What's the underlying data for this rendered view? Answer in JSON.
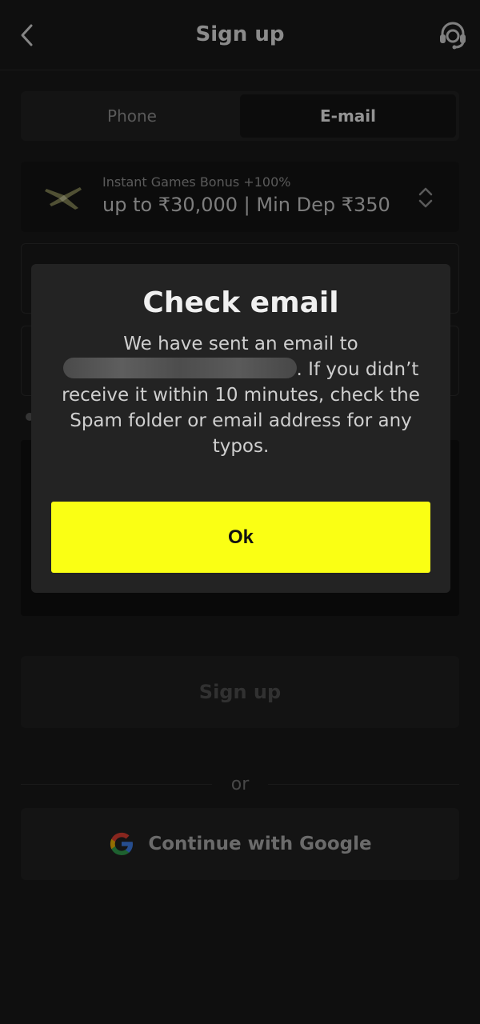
{
  "header": {
    "title": "Sign up",
    "back_icon": "chevron-left-icon",
    "support_icon": "headset-support-icon"
  },
  "tabs": [
    {
      "label": "Phone",
      "active": false
    },
    {
      "label": "E-mail",
      "active": true
    }
  ],
  "bonus": {
    "subtitle": "Instant Games Bonus +100%",
    "title": "up to ₹30,000 | Min Dep ₹350",
    "icon": "airplane-icon",
    "toggle_icon": "sort-chevrons-icon"
  },
  "signup_button": {
    "label": "Sign up"
  },
  "divider": {
    "label": "or"
  },
  "google_button": {
    "label": "Continue with Google",
    "icon": "google-icon"
  },
  "modal": {
    "title": "Check email",
    "body_prefix": "We have sent an email to",
    "body_suffix": ". If you didn’t receive it within 10 minutes, check the Spam folder or email address for any typos.",
    "ok_label": "Ok"
  },
  "colors": {
    "accent": "#faff14",
    "background": "#1a1a1a",
    "modal_bg": "#232323"
  }
}
